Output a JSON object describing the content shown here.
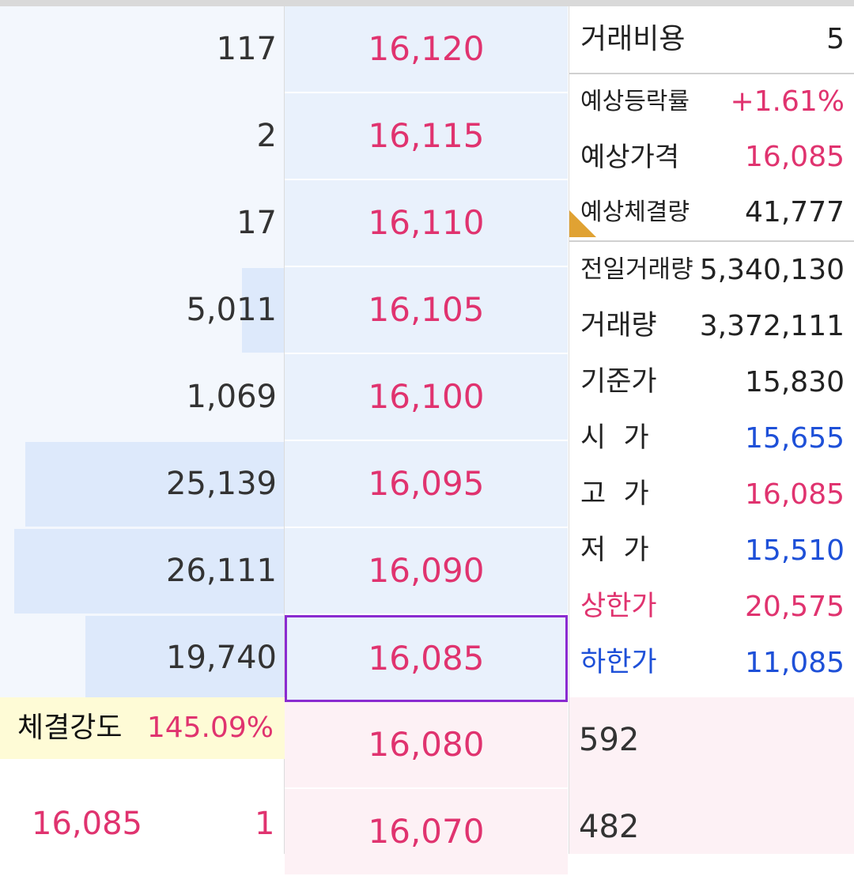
{
  "colors": {
    "up": "#e0336f",
    "down": "#1e50d8",
    "neutral": "#333333",
    "current_border": "#8a2bd0",
    "ask_bg": "#e9f1fc",
    "bid_bg": "#fdf1f5",
    "strength_bg": "#fefbd6",
    "marker": "#e0a233"
  },
  "asks": [
    {
      "qty": "117",
      "price": "16,120",
      "bar": 0.0
    },
    {
      "qty": "2",
      "price": "16,115",
      "bar": 0.0
    },
    {
      "qty": "17",
      "price": "16,110",
      "bar": 0.0
    },
    {
      "qty": "5,011",
      "price": "16,105",
      "bar": 0.15
    },
    {
      "qty": "1,069",
      "price": "16,100",
      "bar": 0.0
    },
    {
      "qty": "25,139",
      "price": "16,095",
      "bar": 0.91
    },
    {
      "qty": "26,111",
      "price": "16,090",
      "bar": 0.95
    },
    {
      "qty": "19,740",
      "price": "16,085",
      "bar": 0.7
    }
  ],
  "bids": [
    {
      "qty": "592",
      "price": "16,080"
    },
    {
      "qty": "482",
      "price": "16,070"
    }
  ],
  "info": {
    "fee": {
      "label": "거래비용",
      "value": "5"
    },
    "expected": [
      {
        "label": "예상등락률",
        "value": "+1.61%",
        "tone": "up"
      },
      {
        "label": "예상가격",
        "value": "16,085",
        "tone": "up"
      },
      {
        "label": "예상체결량",
        "value": "41,777",
        "tone": "neutral"
      }
    ],
    "stats": [
      {
        "label": "전일거래량",
        "value": "5,340,130",
        "label_tone": "neutral",
        "tone": "neutral"
      },
      {
        "label": "거래량",
        "value": "3,372,111",
        "label_tone": "neutral",
        "tone": "neutral"
      },
      {
        "label": "기준가",
        "value": "15,830",
        "label_tone": "neutral",
        "tone": "neutral"
      },
      {
        "label": "시  가",
        "value": "15,655",
        "label_tone": "neutral",
        "tone": "down"
      },
      {
        "label": "고  가",
        "value": "16,085",
        "label_tone": "neutral",
        "tone": "up"
      },
      {
        "label": "저  가",
        "value": "15,510",
        "label_tone": "neutral",
        "tone": "down"
      },
      {
        "label": "상한가",
        "value": "20,575",
        "label_tone": "up",
        "tone": "up"
      },
      {
        "label": "하한가",
        "value": "11,085",
        "label_tone": "down",
        "tone": "down"
      }
    ]
  },
  "strength": {
    "label": "체결강도",
    "value": "145.09%"
  },
  "last_trade": {
    "price": "16,085",
    "qty": "1"
  }
}
